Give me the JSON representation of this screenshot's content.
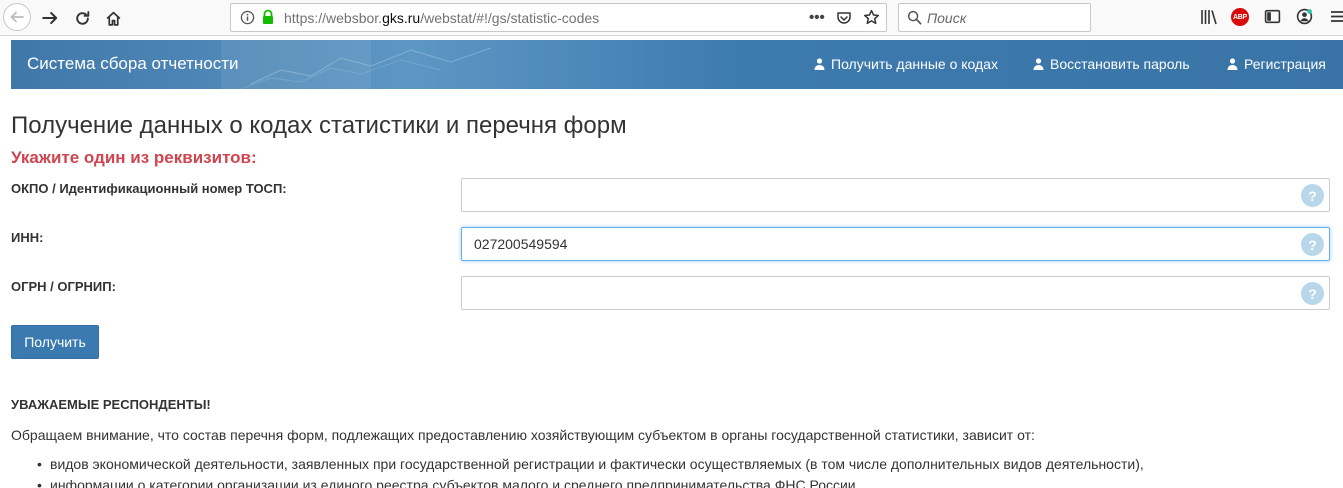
{
  "browser": {
    "url_prefix": "https://websbor.",
    "url_host": "gks.ru",
    "url_path": "/webstat/#!/gs/statistic-codes",
    "search_placeholder": "Поиск",
    "abp_label": "ABP"
  },
  "header": {
    "title": "Система сбора отчетности",
    "links": [
      {
        "label": "Получить данные о кодах",
        "icon": "user-icon"
      },
      {
        "label": "Восстановить пароль",
        "icon": "user-icon"
      },
      {
        "label": "Регистрация",
        "icon": "user-icon"
      }
    ]
  },
  "main": {
    "title": "Получение данных о кодах статистики и перечня форм",
    "subtitle": "Укажите один из реквизитов:",
    "fields": {
      "okpo": {
        "label": "ОКПО / Идентификационный номер ТОСП:",
        "value": ""
      },
      "inn": {
        "label": "ИНН:",
        "value": "027200549594"
      },
      "ogrn": {
        "label": "ОГРН / ОГРНИП:",
        "value": ""
      }
    },
    "help_symbol": "?",
    "submit_label": "Получить"
  },
  "notice": {
    "heading": "УВАЖАЕМЫЕ РЕСПОНДЕНТЫ!",
    "text": "Обращаем внимание, что состав перечня форм, подлежащих предоставлению хозяйствующим субъектом в органы государственной статистики, зависит от:",
    "items": [
      "видов экономической деятельности, заявленных при государственной регистрации и фактически осуществляемых (в том числе дополнительных видов деятельности),",
      "информации о категории организации из единого реестра субъектов малого и среднего предпринимательства ФНС России"
    ]
  },
  "colors": {
    "header_bg": "#3f77a9",
    "subtitle": "#d0454f",
    "button": "#3a7ab0",
    "help_icon": "#b8d7ea"
  }
}
